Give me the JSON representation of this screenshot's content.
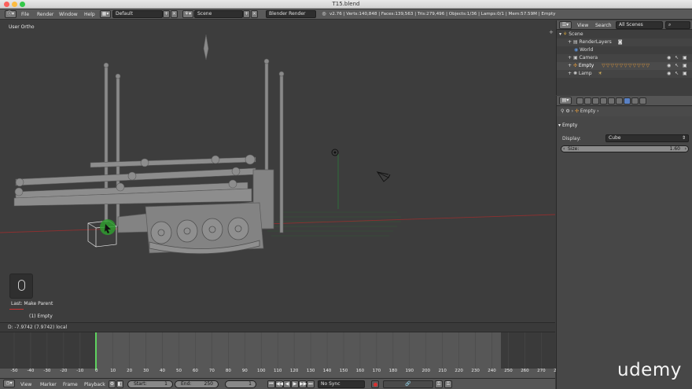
{
  "window": {
    "title": "T15.blend"
  },
  "info_header": {
    "menus": [
      "File",
      "Render",
      "Window",
      "Help"
    ],
    "screen_layout": "Default",
    "scene": "Scene",
    "render_engine": "Blender Render",
    "stats": "v2.76 | Verts:140,848 | Faces:139,563 | Tris:279,496 | Objects:1/36 | Lamps:0/1 | Mem:57.59M | Empty"
  },
  "viewport": {
    "view_label": "User Ortho",
    "operator_label": "Last: Make Parent",
    "object_label": "(1) Empty",
    "status_text": "D: -7.9742 (7.9742) local"
  },
  "timeline": {
    "ticks": [
      "-50",
      "-40",
      "-30",
      "-20",
      "-10",
      "0",
      "10",
      "20",
      "30",
      "40",
      "50",
      "60",
      "70",
      "80",
      "90",
      "100",
      "110",
      "120",
      "130",
      "140",
      "150",
      "160",
      "170",
      "180",
      "190",
      "200",
      "210",
      "220",
      "230",
      "240",
      "250",
      "260",
      "270",
      "280"
    ],
    "menus": [
      "View",
      "Marker",
      "Frame",
      "Playback"
    ],
    "start_label": "Start:",
    "start_value": "1",
    "end_label": "End:",
    "end_value": "250",
    "current_frame": "1",
    "sync": "No Sync"
  },
  "outliner": {
    "menus": [
      "View",
      "Search"
    ],
    "filter": "All Scenes",
    "items": [
      {
        "label": "Scene"
      },
      {
        "label": "RenderLayers"
      },
      {
        "label": "World"
      },
      {
        "label": "Camera"
      },
      {
        "label": "Empty"
      },
      {
        "label": "Lamp"
      }
    ]
  },
  "properties": {
    "breadcrumb": "Empty",
    "panel_title": "Empty",
    "display_label": "Display:",
    "display_value": "Cube",
    "size_label": "Size:",
    "size_value": "1.60"
  },
  "watermark": "udemy",
  "colors": {
    "viewport_bg": "#3d3d3d",
    "grid_green": "#2f8a3a",
    "axis_red": "#9a3030",
    "selection_green": "#35a035",
    "timeline_current": "#5fd35f"
  }
}
